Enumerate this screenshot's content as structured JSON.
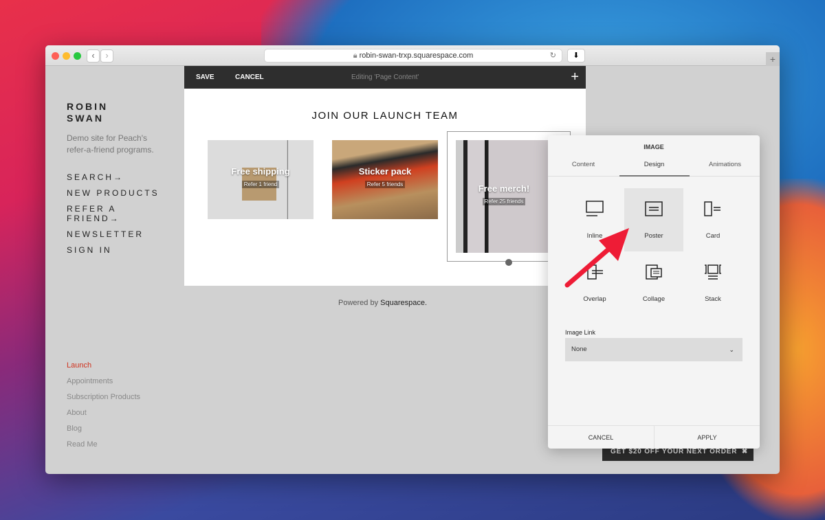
{
  "browser": {
    "url": "robin-swan-trxp.squarespace.com",
    "back": "‹",
    "forward": "›"
  },
  "site": {
    "title_line1": "ROBIN",
    "title_line2": "SWAN",
    "tagline_line1": "Demo site for Peach's",
    "tagline_line2": "refer-a-friend programs.",
    "nav": [
      "SEARCH→",
      "NEW PRODUCTS",
      "REFER A",
      "FRIEND→",
      "NEWSLETTER",
      "SIGN IN"
    ],
    "pages": [
      {
        "label": "Launch",
        "active": true
      },
      {
        "label": "Appointments"
      },
      {
        "label": "Subscription Products"
      },
      {
        "label": "About"
      },
      {
        "label": "Blog"
      },
      {
        "label": "Read Me"
      }
    ],
    "powered": "Powered by",
    "powered_brand": "Squarespace."
  },
  "editor": {
    "save": "SAVE",
    "cancel": "CANCEL",
    "status": "Editing 'Page Content'",
    "add": "+",
    "heading": "JOIN OUR LAUNCH TEAM",
    "cards": [
      {
        "title": "Free shipping",
        "sub": "Refer 1 friend"
      },
      {
        "title": "Sticker pack",
        "sub": "Refer 5 friends"
      },
      {
        "title": "Free merch!",
        "sub": "Refer 25 friends"
      }
    ]
  },
  "panel": {
    "title": "IMAGE",
    "tabs": [
      "Content",
      "Design",
      "Animations"
    ],
    "active_tab": "Design",
    "layouts": [
      "Inline",
      "Poster",
      "Card",
      "Overlap",
      "Collage",
      "Stack"
    ],
    "selected_layout": "Poster",
    "link_label": "Image Link",
    "link_value": "None",
    "cancel": "CANCEL",
    "apply": "APPLY"
  },
  "promo": {
    "text": "GET $20 OFF YOUR NEXT ORDER",
    "close": "✖"
  },
  "colors": {
    "accent_red": "#e8202a",
    "editor_bar": "#2e2e2e",
    "active_page": "#d0321e"
  }
}
